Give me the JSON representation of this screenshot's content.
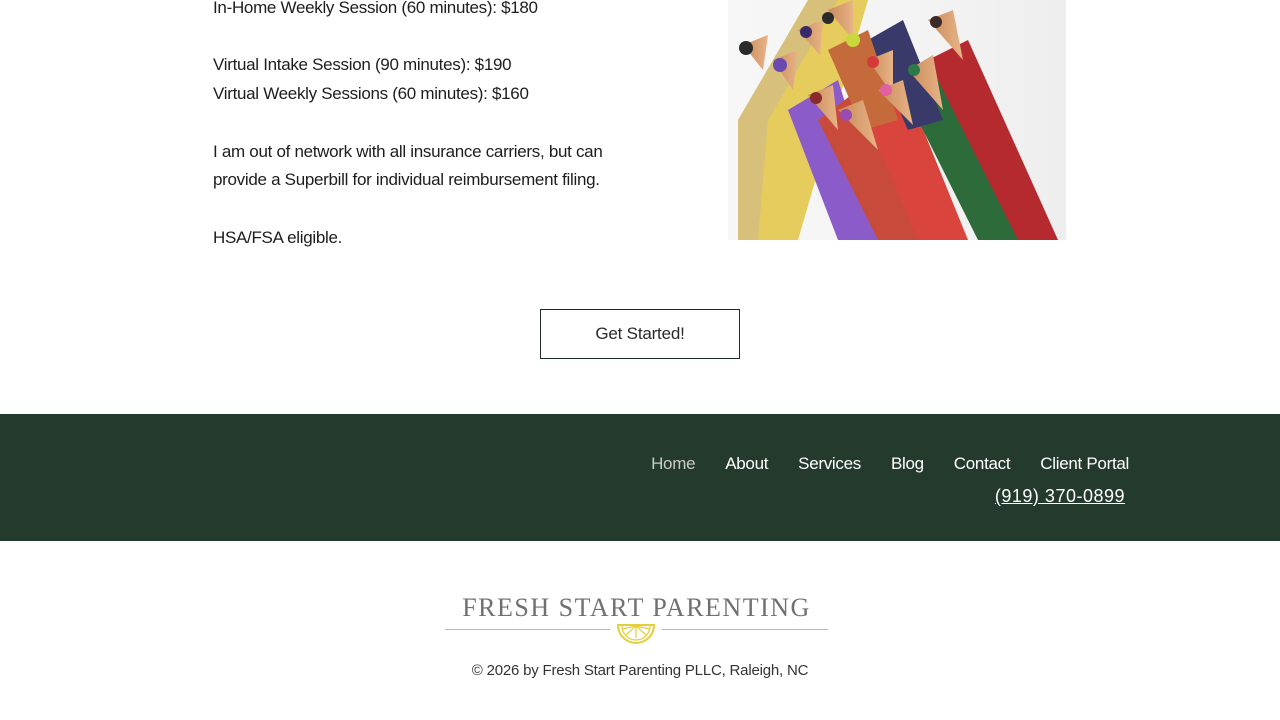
{
  "pricing": {
    "in_home_weekly": "In-Home Weekly Session (60 minutes):   $180",
    "virtual_intake": "Virtual Intake Session (90 minutes):   $190",
    "virtual_weekly": "Virtual Weekly Sessions (60 minutes):   $160",
    "insurance_line1": "I am out of network with all insurance carriers, but can",
    "insurance_line2": "provide a Superbill for individual reimbursement filing.",
    "hsa": "HSA/FSA eligible."
  },
  "image": {
    "subject": "colored-pencils-photo"
  },
  "cta": {
    "label": "Get Started!"
  },
  "footer": {
    "nav": [
      {
        "label": "Home",
        "active": true
      },
      {
        "label": "About"
      },
      {
        "label": "Services"
      },
      {
        "label": "Blog"
      },
      {
        "label": "Contact"
      },
      {
        "label": "Client Portal"
      }
    ],
    "phone": "(919) 370-0899",
    "background": "#233a2d"
  },
  "brand": {
    "name": "FRESH START PARENTING",
    "logo_icon": "lemon-slice-icon",
    "accent": "#e8d84a"
  },
  "copyright": "© 2026 by Fresh Start Parenting PLLC, Raleigh, NC"
}
